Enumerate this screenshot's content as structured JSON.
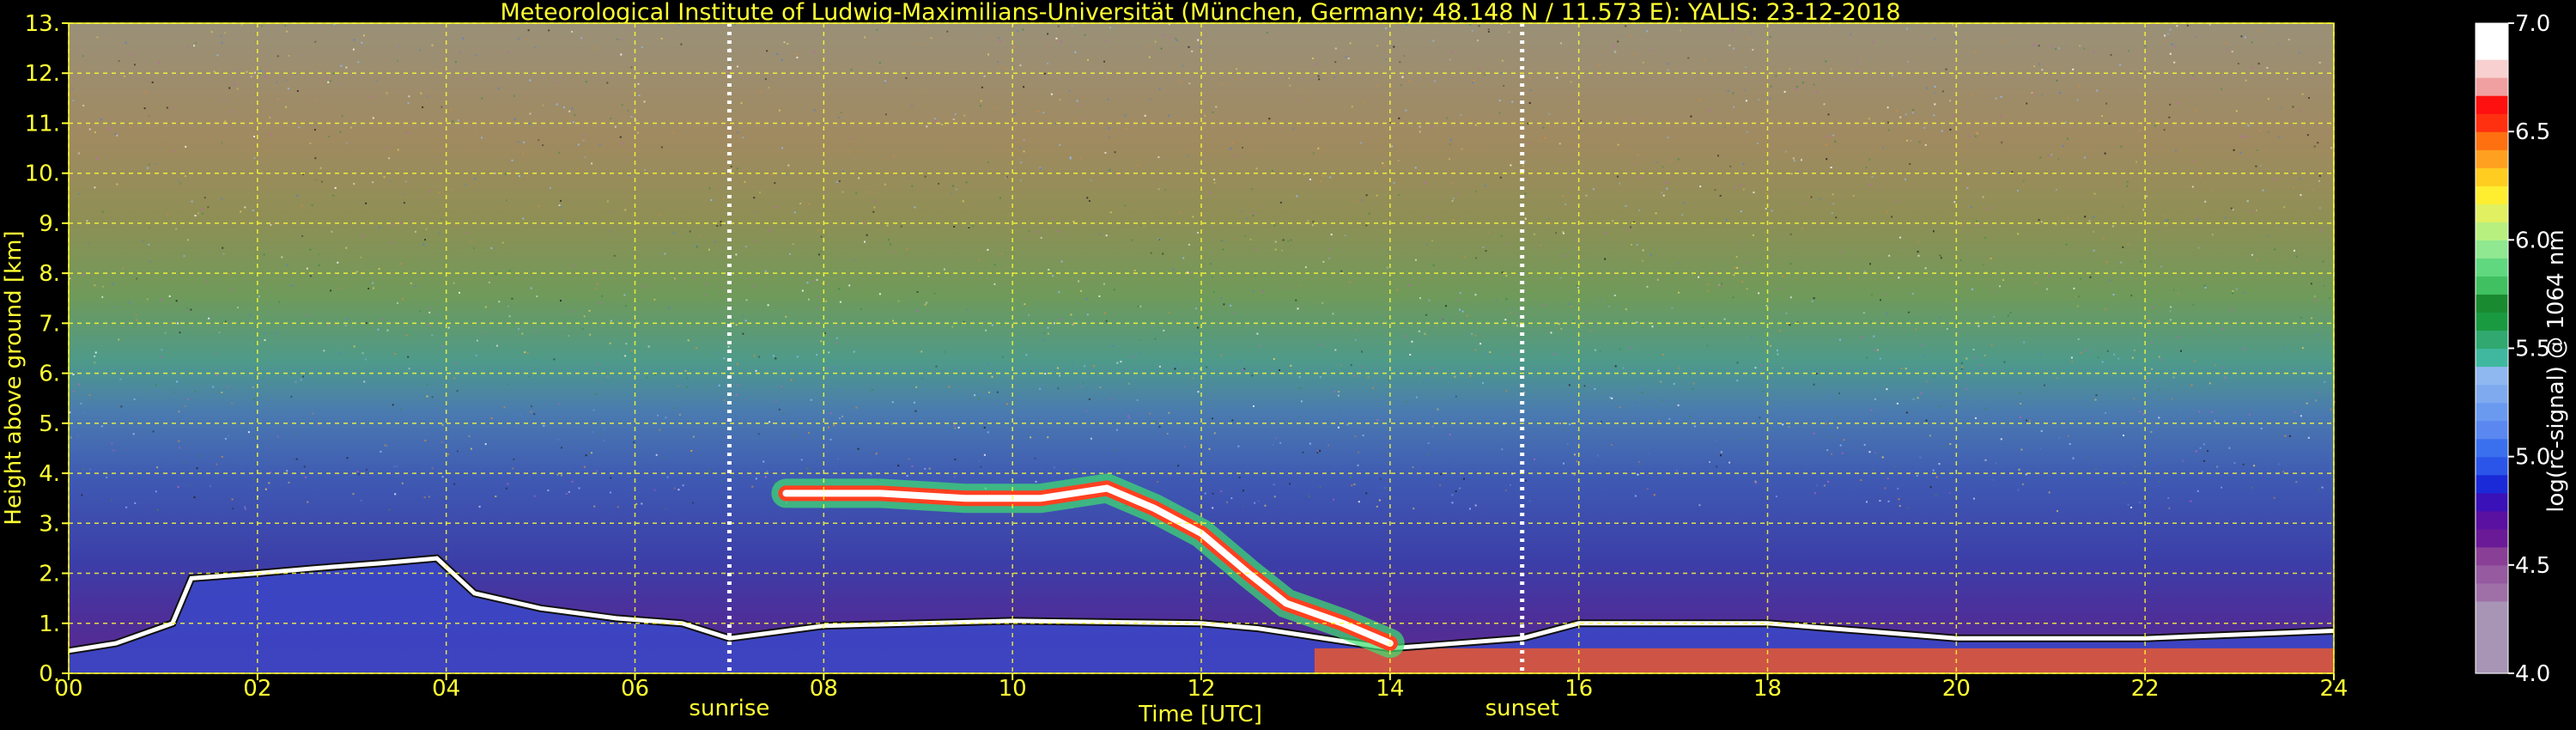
{
  "chart_data": {
    "type": "heatmap",
    "title": "Meteorological Institute of Ludwig-Maximilians-Universität (München, Germany; 48.148 N / 11.573 E):    YALIS: 23-12-2018",
    "xlabel": "Time [UTC]",
    "ylabel": "Height above ground [km]",
    "xlim": [
      0,
      24
    ],
    "ylim": [
      0,
      13
    ],
    "x_ticks": [
      0,
      2,
      4,
      6,
      8,
      10,
      12,
      14,
      16,
      18,
      20,
      22,
      24
    ],
    "x_tick_labels": [
      "00",
      "02",
      "04",
      "06",
      "08",
      "10",
      "12",
      "14",
      "16",
      "18",
      "20",
      "22",
      "24"
    ],
    "y_ticks": [
      0,
      1,
      2,
      3,
      4,
      5,
      6,
      7,
      8,
      9,
      10,
      11,
      12,
      13
    ],
    "y_tick_labels": [
      "0.",
      "1.",
      "2.",
      "3.",
      "4.",
      "5.",
      "6.",
      "7.",
      "8.",
      "9.",
      "10.",
      "11.",
      "12.",
      "13."
    ],
    "grid": true,
    "markers": [
      {
        "label": "sunrise",
        "x": 7.0
      },
      {
        "label": "sunset",
        "x": 15.4
      }
    ],
    "colorbar": {
      "label": "log(rc-signal) @ 1064 nm",
      "range": [
        4.0,
        7.0
      ],
      "ticks": [
        4.0,
        4.5,
        5.0,
        5.5,
        6.0,
        6.5,
        7.0
      ],
      "tick_labels": [
        "4.0",
        "4.5",
        "5.0",
        "5.5",
        "6.0",
        "6.5",
        "7.0"
      ]
    },
    "features": {
      "boundary_layer_top": [
        {
          "x": 0.0,
          "y": 0.45
        },
        {
          "x": 0.5,
          "y": 0.6
        },
        {
          "x": 1.1,
          "y": 1.0
        },
        {
          "x": 1.3,
          "y": 1.9
        },
        {
          "x": 2.0,
          "y": 2.0
        },
        {
          "x": 2.6,
          "y": 2.1
        },
        {
          "x": 3.3,
          "y": 2.2
        },
        {
          "x": 3.9,
          "y": 2.3
        },
        {
          "x": 4.3,
          "y": 1.6
        },
        {
          "x": 5.0,
          "y": 1.3
        },
        {
          "x": 5.8,
          "y": 1.1
        },
        {
          "x": 6.5,
          "y": 1.0
        },
        {
          "x": 7.0,
          "y": 0.7
        },
        {
          "x": 8.0,
          "y": 0.95
        },
        {
          "x": 10.0,
          "y": 1.05
        },
        {
          "x": 12.0,
          "y": 1.0
        },
        {
          "x": 12.6,
          "y": 0.9
        },
        {
          "x": 14.0,
          "y": 0.5
        },
        {
          "x": 15.4,
          "y": 0.7
        },
        {
          "x": 16.0,
          "y": 1.0
        },
        {
          "x": 18.0,
          "y": 1.0
        },
        {
          "x": 20.0,
          "y": 0.7
        },
        {
          "x": 22.0,
          "y": 0.7
        },
        {
          "x": 24.0,
          "y": 0.85
        }
      ],
      "elevated_layer": [
        {
          "x": 7.6,
          "y": 3.6
        },
        {
          "x": 8.6,
          "y": 3.6
        },
        {
          "x": 9.5,
          "y": 3.5
        },
        {
          "x": 10.3,
          "y": 3.5
        },
        {
          "x": 11.0,
          "y": 3.7
        },
        {
          "x": 11.5,
          "y": 3.3
        },
        {
          "x": 12.0,
          "y": 2.8
        },
        {
          "x": 12.5,
          "y": 2.0
        },
        {
          "x": 12.9,
          "y": 1.4
        },
        {
          "x": 13.5,
          "y": 1.0
        },
        {
          "x": 14.0,
          "y": 0.6
        }
      ]
    }
  }
}
